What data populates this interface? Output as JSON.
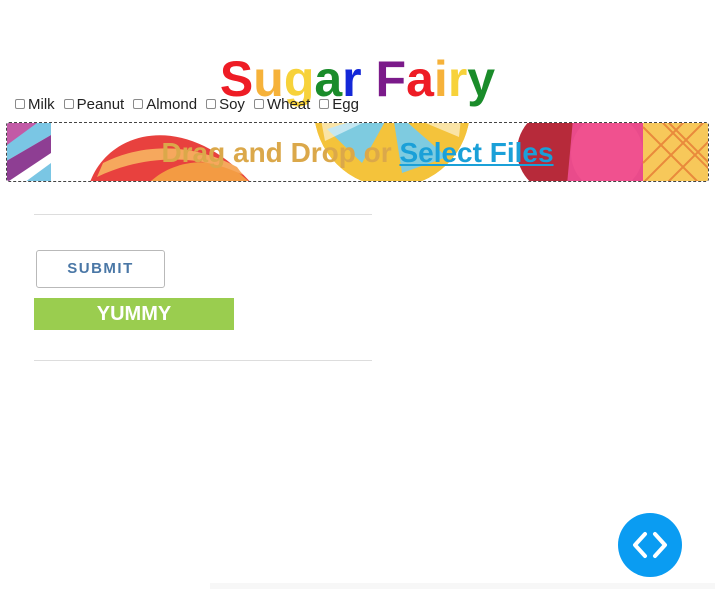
{
  "title": {
    "letters": [
      "S",
      "u",
      "g",
      "a",
      "r",
      " ",
      "F",
      "a",
      "i",
      "r",
      "y"
    ],
    "letter_colors": [
      "#ee1c25",
      "#f6b23a",
      "#f7d23a",
      "#1a8c2a",
      "#1428d8",
      "#000000",
      "#7b1a8a",
      "#ee1c25",
      "#f6b23a",
      "#f7d23a",
      "#1a8c2a"
    ]
  },
  "allergens": [
    {
      "label": "Milk",
      "checked": false
    },
    {
      "label": "Peanut",
      "checked": false
    },
    {
      "label": "Almond",
      "checked": false
    },
    {
      "label": "Soy",
      "checked": false
    },
    {
      "label": "Wheat",
      "checked": false
    },
    {
      "label": "Egg",
      "checked": false
    }
  ],
  "dropzone": {
    "text": "Drag and Drop or ",
    "link": "Select Files"
  },
  "buttons": {
    "submit": "SUBMIT",
    "yummy": "YUMMY"
  },
  "colors": {
    "drop_text": "#dba84a",
    "link": "#1aa0d8",
    "yummy_bg": "#9acd4f",
    "submit_text": "#4a77a6",
    "fab_bg": "#0a9cf2"
  },
  "icons": {
    "fab": "code-icon"
  }
}
